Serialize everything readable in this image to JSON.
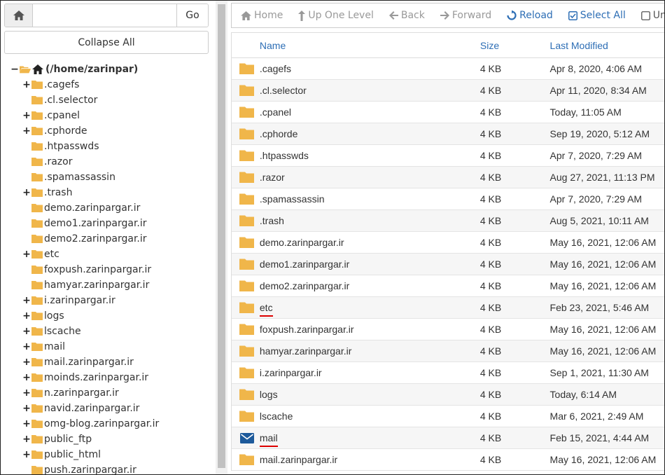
{
  "search": {
    "value": "",
    "go_label": "Go"
  },
  "collapse_label": "Collapse All",
  "tree": {
    "root_label": "(/home/zarinpar)",
    "items": [
      {
        "label": ".cagefs",
        "expandable": true
      },
      {
        "label": ".cl.selector",
        "expandable": false
      },
      {
        "label": ".cpanel",
        "expandable": true
      },
      {
        "label": ".cphorde",
        "expandable": true
      },
      {
        "label": ".htpasswds",
        "expandable": false
      },
      {
        "label": ".razor",
        "expandable": false
      },
      {
        "label": ".spamassassin",
        "expandable": false
      },
      {
        "label": ".trash",
        "expandable": true
      },
      {
        "label": "demo.zarinpargar.ir",
        "expandable": false
      },
      {
        "label": "demo1.zarinpargar.ir",
        "expandable": false
      },
      {
        "label": "demo2.zarinpargar.ir",
        "expandable": false
      },
      {
        "label": "etc",
        "expandable": true
      },
      {
        "label": "foxpush.zarinpargar.ir",
        "expandable": false
      },
      {
        "label": "hamyar.zarinpargar.ir",
        "expandable": false
      },
      {
        "label": "i.zarinpargar.ir",
        "expandable": true
      },
      {
        "label": "logs",
        "expandable": true
      },
      {
        "label": "lscache",
        "expandable": true
      },
      {
        "label": "mail",
        "expandable": true
      },
      {
        "label": "mail.zarinpargar.ir",
        "expandable": true
      },
      {
        "label": "moinds.zarinpargar.ir",
        "expandable": true
      },
      {
        "label": "n.zarinpargar.ir",
        "expandable": true
      },
      {
        "label": "navid.zarinpargar.ir",
        "expandable": true
      },
      {
        "label": "omg-blog.zarinpargar.ir",
        "expandable": true
      },
      {
        "label": "public_ftp",
        "expandable": true
      },
      {
        "label": "public_html",
        "expandable": true
      },
      {
        "label": "push.zarinpargar.ir",
        "expandable": false
      }
    ]
  },
  "toolbar": {
    "home": "Home",
    "up": "Up One Level",
    "back": "Back",
    "forward": "Forward",
    "reload": "Reload",
    "select_all": "Select All",
    "unselect_all": "Unselect All"
  },
  "table": {
    "headers": {
      "name": "Name",
      "size": "Size",
      "modified": "Last Modified"
    },
    "rows": [
      {
        "name": ".cagefs",
        "size": "4 KB",
        "modified": "Apr 8, 2020, 4:06 AM",
        "icon": "folder-icon"
      },
      {
        "name": ".cl.selector",
        "size": "4 KB",
        "modified": "Apr 11, 2020, 8:34 AM",
        "icon": "folder-icon"
      },
      {
        "name": ".cpanel",
        "size": "4 KB",
        "modified": "Today, 11:05 AM",
        "icon": "folder-icon"
      },
      {
        "name": ".cphorde",
        "size": "4 KB",
        "modified": "Sep 19, 2020, 5:12 AM",
        "icon": "folder-icon"
      },
      {
        "name": ".htpasswds",
        "size": "4 KB",
        "modified": "Apr 7, 2020, 7:29 AM",
        "icon": "folder-icon"
      },
      {
        "name": ".razor",
        "size": "4 KB",
        "modified": "Aug 27, 2021, 11:13 PM",
        "icon": "folder-icon"
      },
      {
        "name": ".spamassassin",
        "size": "4 KB",
        "modified": "Apr 7, 2020, 7:29 AM",
        "icon": "folder-icon"
      },
      {
        "name": ".trash",
        "size": "4 KB",
        "modified": "Aug 5, 2021, 10:11 AM",
        "icon": "folder-icon"
      },
      {
        "name": "demo.zarinpargar.ir",
        "size": "4 KB",
        "modified": "May 16, 2021, 12:06 AM",
        "icon": "folder-icon"
      },
      {
        "name": "demo1.zarinpargar.ir",
        "size": "4 KB",
        "modified": "May 16, 2021, 12:06 AM",
        "icon": "folder-icon"
      },
      {
        "name": "demo2.zarinpargar.ir",
        "size": "4 KB",
        "modified": "May 16, 2021, 12:06 AM",
        "icon": "folder-icon"
      },
      {
        "name": "etc",
        "size": "4 KB",
        "modified": "Feb 23, 2021, 5:46 AM",
        "icon": "folder-icon",
        "underline": true
      },
      {
        "name": "foxpush.zarinpargar.ir",
        "size": "4 KB",
        "modified": "May 16, 2021, 12:06 AM",
        "icon": "folder-icon"
      },
      {
        "name": "hamyar.zarinpargar.ir",
        "size": "4 KB",
        "modified": "May 16, 2021, 12:06 AM",
        "icon": "folder-icon"
      },
      {
        "name": "i.zarinpargar.ir",
        "size": "4 KB",
        "modified": "Sep 1, 2021, 11:30 AM",
        "icon": "folder-icon"
      },
      {
        "name": "logs",
        "size": "4 KB",
        "modified": "Today, 6:14 AM",
        "icon": "folder-icon"
      },
      {
        "name": "lscache",
        "size": "4 KB",
        "modified": "Mar 6, 2021, 2:49 AM",
        "icon": "folder-icon"
      },
      {
        "name": "mail",
        "size": "4 KB",
        "modified": "Feb 15, 2021, 4:44 AM",
        "icon": "mail-icon",
        "underline": true
      },
      {
        "name": "mail.zarinpargar.ir",
        "size": "4 KB",
        "modified": "May 16, 2021, 12:06 AM",
        "icon": "folder-icon"
      }
    ]
  },
  "colors": {
    "accent": "#2d6eb5",
    "folder": "#f0b64a",
    "underline": "#dd0000"
  }
}
